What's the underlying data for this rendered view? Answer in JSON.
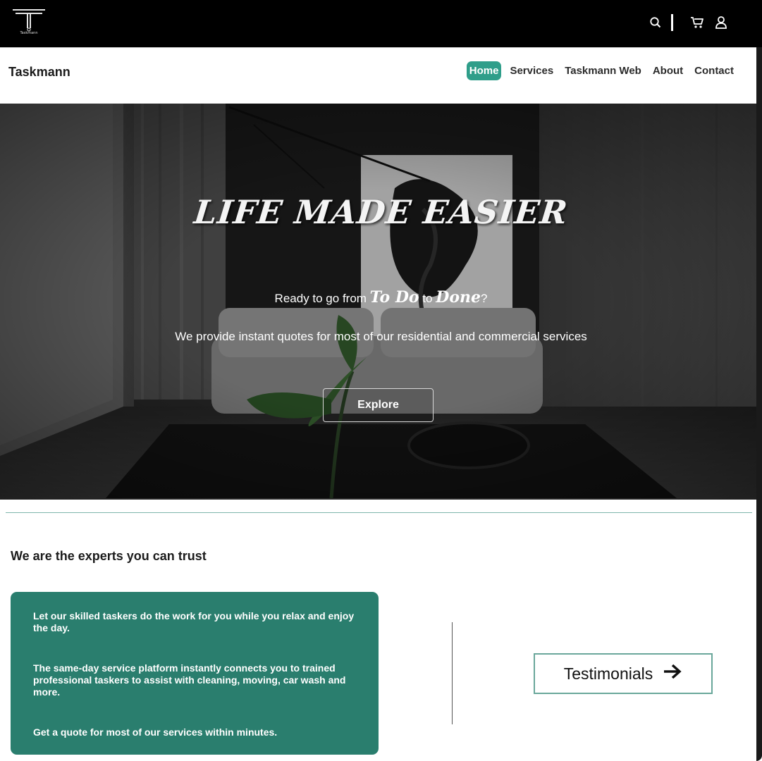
{
  "topbar": {
    "logo_text": "Taskmann",
    "icons": [
      "search-icon",
      "cart-icon",
      "user-icon"
    ]
  },
  "navbar": {
    "brand": "Taskmann",
    "items": [
      {
        "label": "Home",
        "active": true
      },
      {
        "label": "Services",
        "active": false
      },
      {
        "label": "Taskmann Web",
        "active": false
      },
      {
        "label": "About",
        "active": false
      },
      {
        "label": "Contact",
        "active": false
      }
    ]
  },
  "hero": {
    "title": "LIFE MADE EASIER",
    "line1_prefix": "Ready to go from ",
    "line1_todo": "To Do",
    "line1_mid": " to ",
    "line1_done": "Done",
    "line1_suffix": "?",
    "line2": "We provide instant quotes for most of our residential and commercial services",
    "button": "Explore"
  },
  "experts": {
    "heading": "We are the experts you can trust",
    "paragraphs": [
      "Let our skilled taskers do the work for you while you relax and enjoy the day.",
      "The same-day service platform instantly connects you to trained professional taskers to assist with cleaning, moving, car wash and more.",
      "Get a quote for most of our services within minutes."
    ],
    "testimonials_button": "Testimonials"
  },
  "colors": {
    "accent": "#2f9e8a",
    "card_green": "#2a7e6e",
    "divider": "#7fb5ab"
  }
}
